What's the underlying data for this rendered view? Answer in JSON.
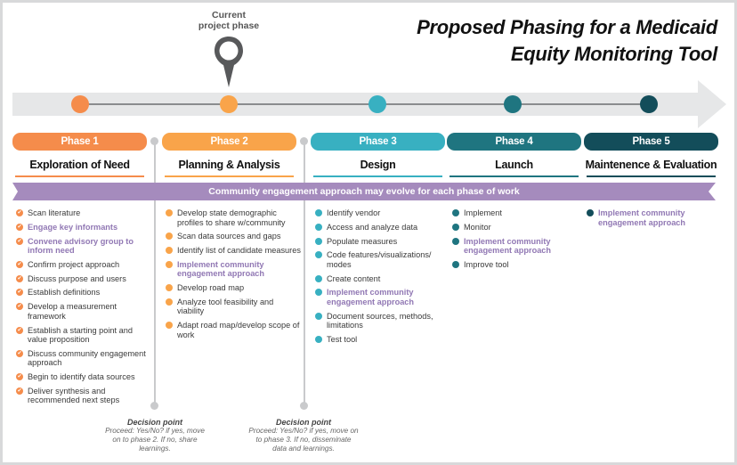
{
  "title": {
    "line1": "Proposed Phasing for a Medicaid",
    "line2": "Equity Monitoring Tool"
  },
  "current_marker": {
    "line1": "Current",
    "line2": "project phase",
    "icon": "map-pin-icon",
    "current_phase_index": 2
  },
  "colors": {
    "phase1": "#f58c4b",
    "phase2": "#f9a44a",
    "phase3": "#38b0c1",
    "phase4": "#1f7580",
    "phase5": "#134d5a",
    "community": "#a58bbd",
    "highlight_text": "#9178b4",
    "track": "#e6e7e8"
  },
  "banner": {
    "text": "Community engagement approach may evolve for each phase of work"
  },
  "phases": [
    {
      "label": "Phase 1",
      "name": "Exploration of Need",
      "bullet": "check-circle-icon",
      "tasks": [
        {
          "text": "Scan literature",
          "community": false
        },
        {
          "text": "Engage key informants",
          "community": true
        },
        {
          "text": "Convene advisory group to inform need",
          "community": true
        },
        {
          "text": "Confirm project approach",
          "community": false
        },
        {
          "text": "Discuss purpose and users",
          "community": false
        },
        {
          "text": "Establish definitions",
          "community": false
        },
        {
          "text": "Develop a measurement framework",
          "community": false
        },
        {
          "text": "Establish a starting point and value proposition",
          "community": false
        },
        {
          "text": "Discuss community engagement approach",
          "community": false
        },
        {
          "text": "Begin to identify data sources",
          "community": false
        },
        {
          "text": "Deliver synthesis and recommended next steps",
          "community": false
        }
      ]
    },
    {
      "label": "Phase 2",
      "name": "Planning & Analysis",
      "bullet": "dot-icon",
      "tasks": [
        {
          "text": "Develop state demographic profiles to share w/community",
          "community": false
        },
        {
          "text": "Scan data sources and gaps",
          "community": false
        },
        {
          "text": "Identify list of candidate measures",
          "community": false
        },
        {
          "text": "Implement community engagement approach",
          "community": true
        },
        {
          "text": "Develop road map",
          "community": false
        },
        {
          "text": "Analyze tool feasibility and viability",
          "community": false
        },
        {
          "text": "Adapt road map/develop scope of work",
          "community": false
        }
      ]
    },
    {
      "label": "Phase 3",
      "name": "Design",
      "bullet": "dot-icon",
      "tasks": [
        {
          "text": "Identify vendor",
          "community": false
        },
        {
          "text": "Access and analyze data",
          "community": false
        },
        {
          "text": "Populate measures",
          "community": false
        },
        {
          "text": "Code features/visualizations/ modes",
          "community": false
        },
        {
          "text": "Create content",
          "community": false
        },
        {
          "text": "Implement community engagement approach",
          "community": true
        },
        {
          "text": "Document sources, methods, limitations",
          "community": false
        },
        {
          "text": "Test tool",
          "community": false
        }
      ]
    },
    {
      "label": "Phase 4",
      "name": "Launch",
      "bullet": "dot-icon",
      "tasks": [
        {
          "text": "Implement",
          "community": false
        },
        {
          "text": "Monitor",
          "community": false
        },
        {
          "text": "Implement community engagement approach",
          "community": true
        },
        {
          "text": "Improve tool",
          "community": false
        }
      ]
    },
    {
      "label": "Phase 5",
      "name": "Maintenence & Evaluation",
      "bullet": "dot-icon",
      "tasks": [
        {
          "text": "Implement community engagement approach",
          "community": true
        }
      ]
    }
  ],
  "decision_points": [
    {
      "title": "Decision point",
      "line1": "Proceed: Yes/No? if yes, move",
      "line2": "on to phase 2. If no, share",
      "line3": "learnings."
    },
    {
      "title": "Decision point",
      "line1": "Proceed: Yes/No? if yes, move on",
      "line2": "to phase 3.  If no, disseminate",
      "line3": "data and learnings."
    }
  ]
}
